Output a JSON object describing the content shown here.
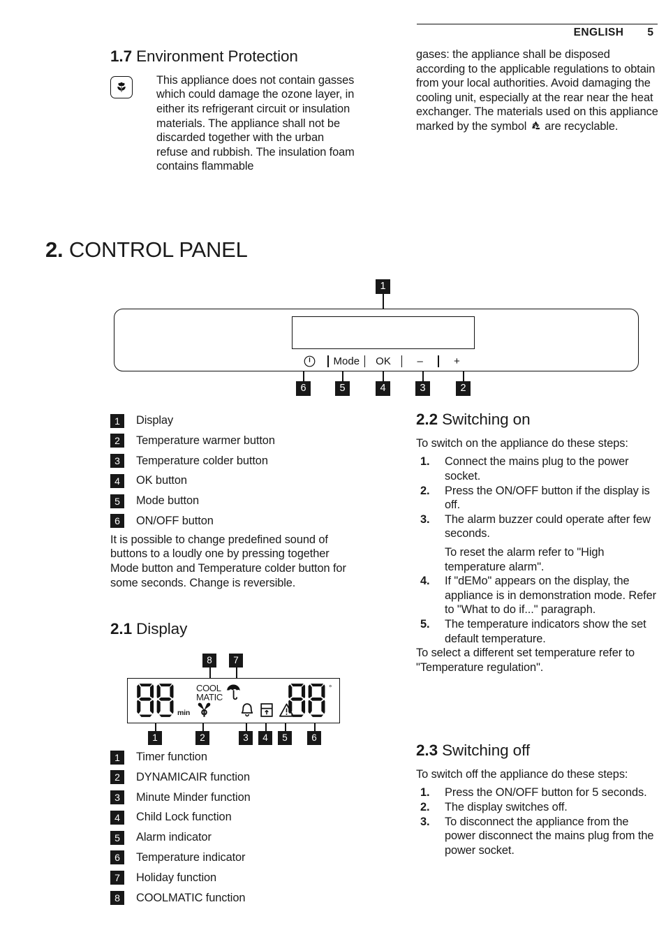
{
  "header": {
    "language": "ENGLISH",
    "page_number": "5"
  },
  "section_1_7": {
    "heading_number": "1.7",
    "heading_title": "Environment Protection",
    "icon": "flower-icon",
    "left_text": "This appliance does not contain gasses which could damage the ozone layer, in either its refrigerant circuit or insulation materials. The appliance shall not be discarded together with the urban refuse and rubbish. The insulation foam contains flammable",
    "right_text_1": "gases: the appliance shall be disposed according to the applicable regulations to obtain from your local authorities. Avoid damaging the cooling unit, especially at the rear near the heat exchanger. The materials used on this appliance marked by the symbol",
    "right_text_2": "are recyclable."
  },
  "chapter_2": {
    "number": "2.",
    "title": "CONTROL PANEL"
  },
  "control_panel_figure": {
    "display_callout": "1",
    "buttons": [
      {
        "label": "",
        "icon": "power-icon",
        "callout": "6",
        "name": "on-off-button"
      },
      {
        "label": "Mode",
        "icon": "",
        "callout": "5",
        "name": "mode-button"
      },
      {
        "label": "OK",
        "icon": "",
        "callout": "4",
        "name": "ok-button"
      },
      {
        "label": "–",
        "icon": "",
        "callout": "3",
        "name": "temperature-colder-button"
      },
      {
        "label": "+",
        "icon": "",
        "callout": "2",
        "name": "temperature-warmer-button"
      }
    ]
  },
  "control_panel_legend": [
    {
      "num": "1",
      "label": "Display"
    },
    {
      "num": "2",
      "label": "Temperature warmer button"
    },
    {
      "num": "3",
      "label": "Temperature colder button"
    },
    {
      "num": "4",
      "label": "OK button"
    },
    {
      "num": "5",
      "label": "Mode button"
    },
    {
      "num": "6",
      "label": "ON/OFF button"
    }
  ],
  "control_panel_note": "It is possible to change predefined sound of buttons to a loudly one by pressing together Mode button and Temperature colder button for some seconds. Change is reversible.",
  "section_2_1": {
    "heading_number": "2.1",
    "heading_title": "Display",
    "display_figure": {
      "timer_digits": "88",
      "timer_unit": "min",
      "coolmatic_line1": "COOL",
      "coolmatic_line2": "MATIC",
      "temperature_digits": "88",
      "degree_symbol": "°",
      "icons": [
        {
          "name": "holiday-umbrella-icon",
          "callout": "7"
        },
        {
          "name": "coolmatic-text",
          "callout": "8"
        },
        {
          "name": "dynamicair-fan-icon",
          "callout": "2"
        },
        {
          "name": "minute-minder-bell-icon",
          "callout": "3"
        },
        {
          "name": "child-lock-icon",
          "callout": "4"
        },
        {
          "name": "alarm-warning-icon",
          "callout": "5"
        },
        {
          "name": "timer-digits",
          "callout": "1"
        },
        {
          "name": "temperature-digits",
          "callout": "6"
        }
      ]
    },
    "legend": [
      {
        "num": "1",
        "label": "Timer function"
      },
      {
        "num": "2",
        "label": "DYNAMICAIR function"
      },
      {
        "num": "3",
        "label": "Minute Minder function"
      },
      {
        "num": "4",
        "label": "Child Lock function"
      },
      {
        "num": "5",
        "label": "Alarm indicator"
      },
      {
        "num": "6",
        "label": "Temperature indicator"
      },
      {
        "num": "7",
        "label": "Holiday function"
      },
      {
        "num": "8",
        "label": "COOLMATIC function"
      }
    ]
  },
  "section_2_2": {
    "heading_number": "2.2",
    "heading_title": "Switching on",
    "intro": "To switch on the appliance do these steps:",
    "steps": [
      {
        "num": "1.",
        "text": "Connect the mains plug to the power socket.",
        "sub": ""
      },
      {
        "num": "2.",
        "text": "Press the ON/OFF button if the display is off.",
        "sub": ""
      },
      {
        "num": "3.",
        "text": "The alarm buzzer could operate after few seconds.",
        "sub": "To reset the alarm refer to \"High temperature alarm\"."
      },
      {
        "num": "4.",
        "text": "If \"dEMo\" appears on the display, the appliance is in demonstration mode. Refer to \"What to do if...\" paragraph.",
        "sub": ""
      },
      {
        "num": "5.",
        "text": "The temperature indicators show the set default temperature.",
        "sub": ""
      }
    ],
    "tail": "To select a different set temperature refer to \"Temperature regulation\"."
  },
  "section_2_3": {
    "heading_number": "2.3",
    "heading_title": "Switching off",
    "intro": "To switch off the appliance do these steps:",
    "steps": [
      {
        "num": "1.",
        "text": "Press the ON/OFF button for 5 seconds.",
        "sub": ""
      },
      {
        "num": "2.",
        "text": "The display switches off.",
        "sub": ""
      },
      {
        "num": "3.",
        "text": "To disconnect the appliance from the power disconnect the mains plug from the power socket.",
        "sub": ""
      }
    ]
  },
  "colors": {
    "ink": "#1a1a1a",
    "badge_bg": "#181818",
    "badge_fg": "#ffffff"
  }
}
